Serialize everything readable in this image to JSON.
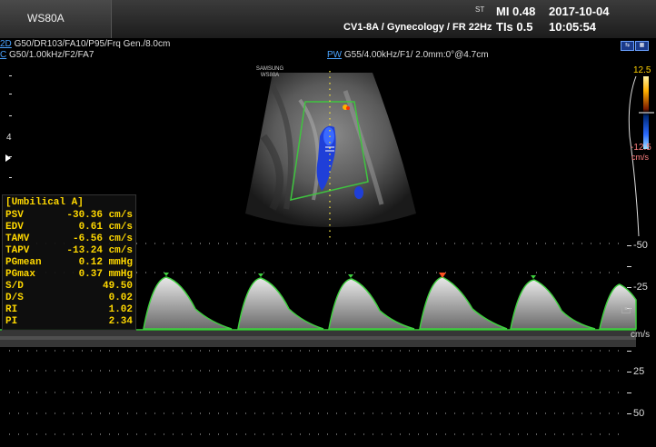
{
  "header": {
    "model": "WS80A",
    "st": "ST",
    "mi": "MI  0.48",
    "tis": "TIs 0.5",
    "date": "2017-10-04",
    "time": "10:05:54",
    "preset": "CV1-8A / Gynecology / FR 22Hz"
  },
  "params": {
    "tag_2d": "2D",
    "line_2d": " G50/DR103/FA10/P95/Frq Gen./8.0cm",
    "tag_c": "C",
    "line_c": " G50/1.00kHz/F2/FA7",
    "tag_pw": "PW",
    "line_pw": " G55/4.00kHz/F1/ 2.0mm:0°@4.7cm"
  },
  "watermark": {
    "line1": "SAMSUNG",
    "line2": "WS80A"
  },
  "color_scale": {
    "top": "12.5",
    "bottom": "-12.5",
    "unit": "cm/s",
    "top_color": "#ffd000",
    "bottom_color": "#2060ff"
  },
  "depth_marker": "4",
  "calc": {
    "title": "[Umbilical A]",
    "rows": [
      {
        "label": "PSV",
        "value": "-30.36 cm/s"
      },
      {
        "label": "EDV",
        "value": "0.61 cm/s"
      },
      {
        "label": "TAMV",
        "value": "-6.56 cm/s"
      },
      {
        "label": "TAPV",
        "value": "-13.24 cm/s"
      },
      {
        "label": "PGmean",
        "value": "0.12 mmHg"
      },
      {
        "label": "PGmax",
        "value": "0.37 mmHg"
      },
      {
        "label": "S/D",
        "value": "49.50"
      },
      {
        "label": "D/S",
        "value": "0.02"
      },
      {
        "label": "RI",
        "value": "1.02"
      },
      {
        "label": "PI",
        "value": "2.34"
      }
    ]
  },
  "velocity_scale": {
    "t1": "-50",
    "t2": "-25",
    "unit": "cm/s",
    "t3": "25",
    "t4": "50"
  },
  "icons": {
    "top_right": "display-mode-icon",
    "bottom": "wave-icon"
  }
}
